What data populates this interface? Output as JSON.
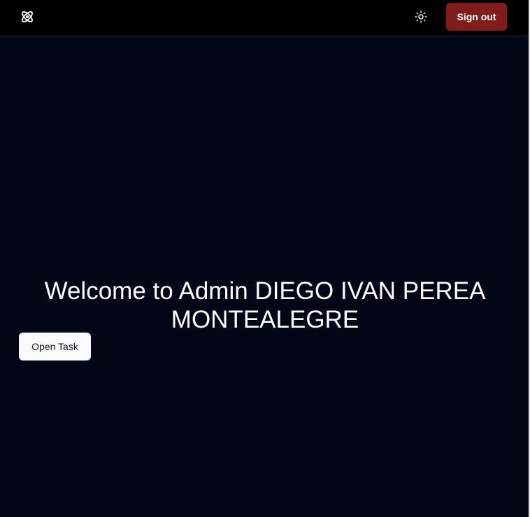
{
  "header": {
    "logo_icon": "atom-icon",
    "theme_toggle_icon": "sun-icon",
    "sign_out_label": "Sign out"
  },
  "main": {
    "welcome_line1": "Welcome to Admin DIEGO IVAN PEREA",
    "welcome_line2": "MONTEALEGRE",
    "open_task_label": "Open Task"
  },
  "colors": {
    "background": "#020617",
    "header_background": "#000000",
    "sign_out_button": "#7f1d1d",
    "open_task_button": "#f8fafc"
  }
}
